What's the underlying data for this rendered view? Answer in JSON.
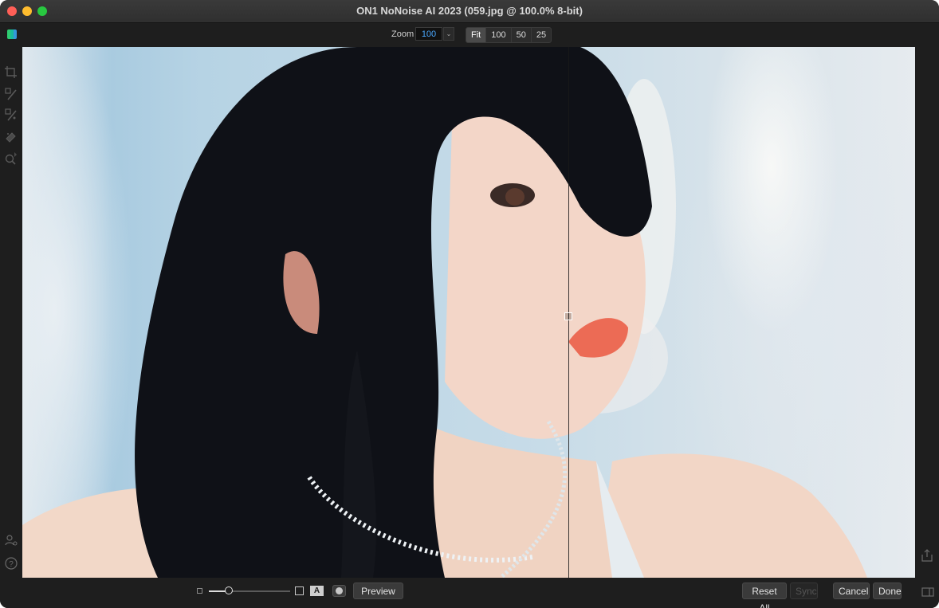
{
  "window": {
    "title": "ON1 NoNoise AI 2023 (059.jpg @ 100.0% 8-bit)"
  },
  "toolbar": {
    "zoom_label": "Zoom",
    "zoom_value": "100",
    "zoom_presets": [
      {
        "label": "Fit",
        "active": true
      },
      {
        "label": "100",
        "active": false
      },
      {
        "label": "50",
        "active": false
      },
      {
        "label": "25",
        "active": false
      }
    ]
  },
  "tools": {
    "left": [
      "crop-icon",
      "brush-icon",
      "refine-brush-icon",
      "retouch-icon",
      "zoom-tool-icon"
    ],
    "left_bottom": [
      "user-account-icon",
      "help-icon"
    ],
    "right_bottom": [
      "export-icon",
      "panel-toggle-icon"
    ]
  },
  "bottom": {
    "preview_label": "Preview",
    "reset_all_label": "Reset All",
    "sync_label": "Sync",
    "cancel_label": "Cancel",
    "done_label": "Done",
    "mode_a_label": "A"
  },
  "colors": {
    "accent_blue": "#4aa8ff",
    "window_bg": "#1e1e1e",
    "button_bg": "#3a3a3a"
  }
}
